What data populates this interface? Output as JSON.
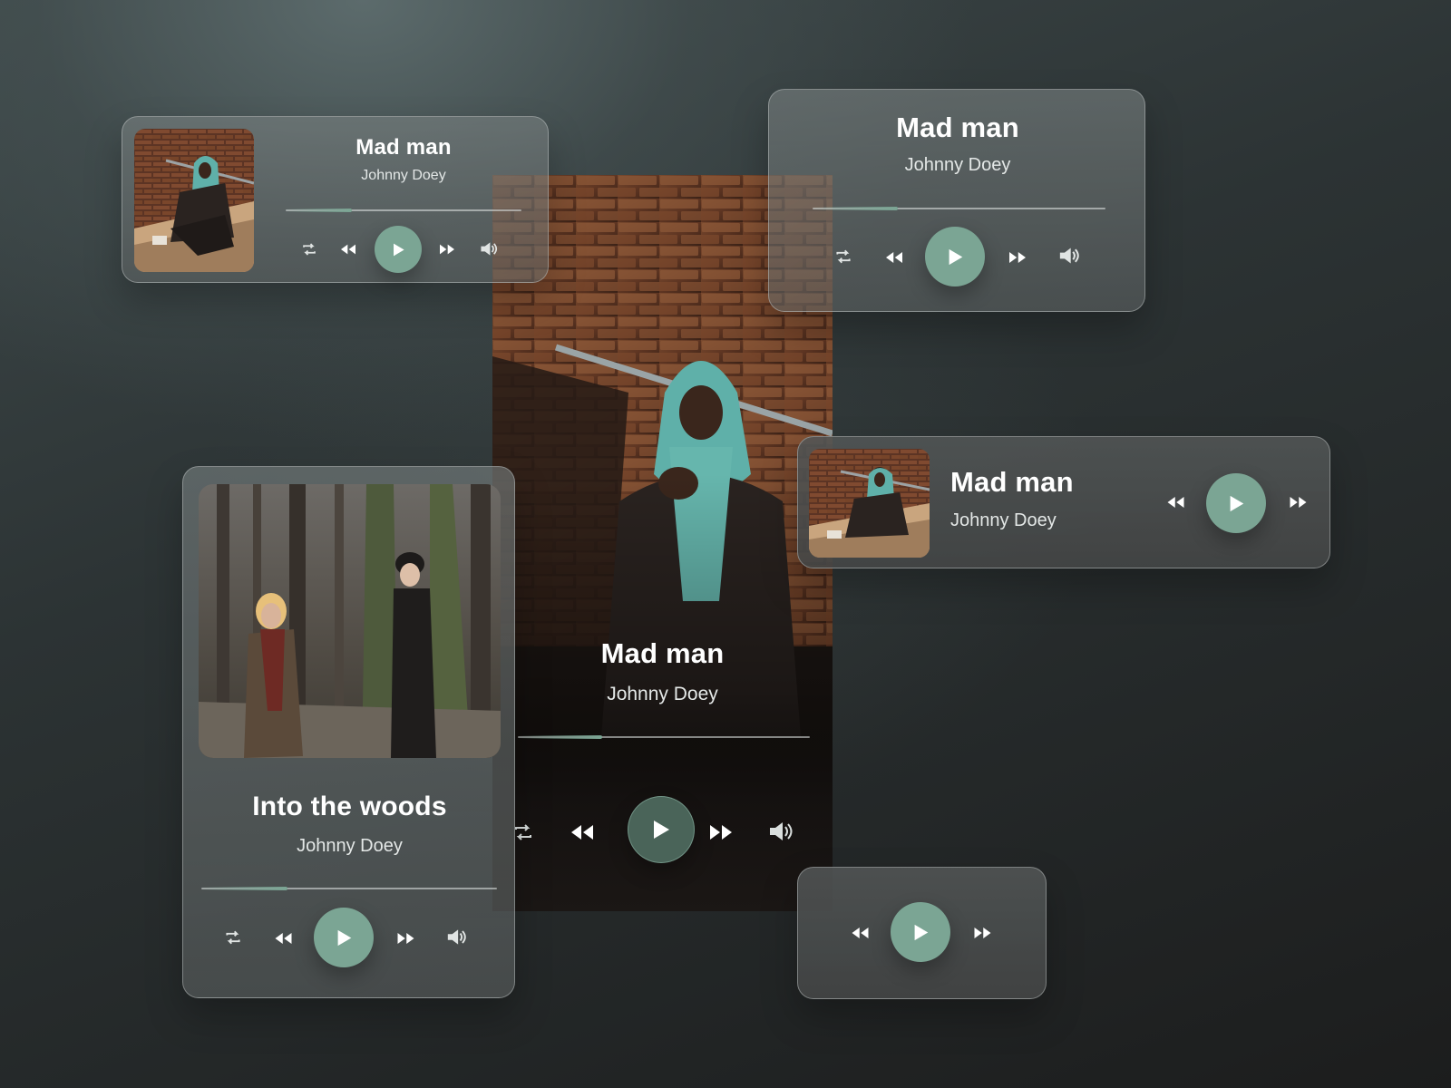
{
  "colors": {
    "accent": "#7ba594",
    "accent_dark": "#4f6a5f",
    "background": "#2a3132"
  },
  "icons": {
    "repeat": "repeat-icon",
    "rewind": "rewind-icon",
    "play": "play-icon",
    "fast_forward": "fast-forward-icon",
    "volume": "volume-icon"
  },
  "players": {
    "compact_top_left": {
      "title": "Mad man",
      "artist": "Johnny Doey",
      "progress": 0.28
    },
    "top_right": {
      "title": "Mad man",
      "artist": "Johnny Doey",
      "progress": 0.29
    },
    "main": {
      "title": "Mad man",
      "artist": "Johnny Doey",
      "progress": 0.29
    },
    "card": {
      "title": "Into the woods",
      "artist": "Johnny Doey",
      "progress": 0.29
    },
    "horizontal": {
      "title": "Mad man",
      "artist": "Johnny Doey"
    },
    "mini": {}
  }
}
